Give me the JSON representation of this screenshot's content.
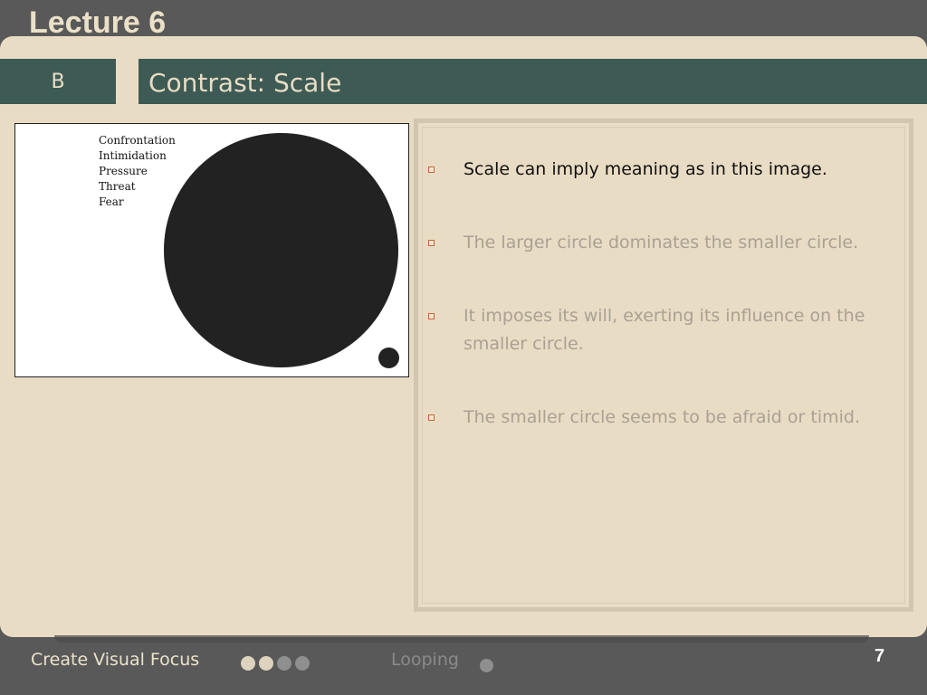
{
  "header": {
    "lecture_title": "Lecture 6"
  },
  "slide": {
    "section_label": "B",
    "title": "Contrast: Scale",
    "image": {
      "words": [
        "Confrontation",
        "Intimidation",
        "Pressure",
        "Threat",
        "Fear"
      ]
    },
    "bullets": [
      {
        "text": "Scale can imply meaning as in this image.",
        "state": "active"
      },
      {
        "text": "The larger circle dominates the smaller circle.",
        "state": "dim"
      },
      {
        "text": "It imposes its will, exerting its influence on the smaller circle.",
        "state": "dim"
      },
      {
        "text": "The smaller circle seems to  be afraid or timid.",
        "state": "dim"
      }
    ]
  },
  "footer": {
    "section_name": "Create Visual Focus",
    "section_progress_dots": [
      true,
      true,
      false,
      false
    ],
    "next_section_name": "Looping",
    "next_section_dots": [
      false
    ],
    "page_number": "7"
  },
  "colors": {
    "background": "#595959",
    "slide": "#e9dcc4",
    "title_bar": "#3d5a55",
    "bullet_marker": "#c8643c"
  }
}
